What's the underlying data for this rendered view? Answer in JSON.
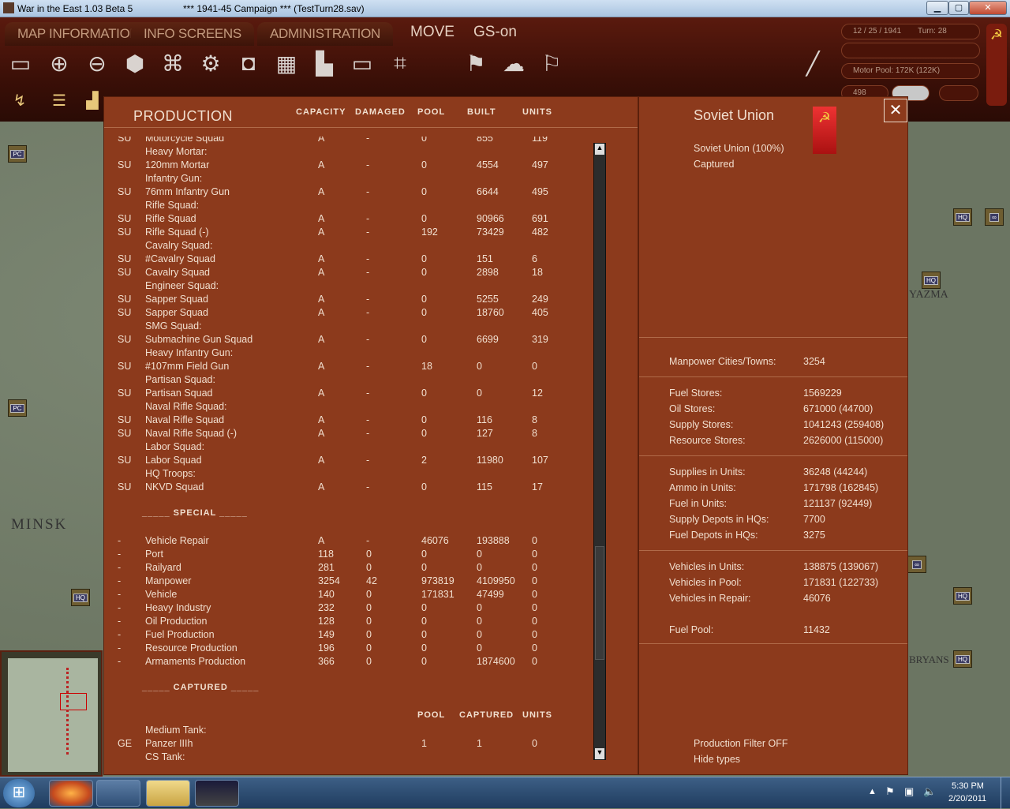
{
  "window": {
    "title": "War in the East 1.03 Beta 5",
    "scenario": "***   1941-45 Campaign   ***  (TestTurn28.sav)",
    "min": "▁",
    "max": "▢",
    "close": "✕"
  },
  "menu": {
    "map_info": "MAP INFORMATION",
    "info_screens": "INFO SCREENS",
    "administration": "ADMINISTRATION",
    "mode": "MOVE",
    "gs": "GS-on"
  },
  "status": {
    "date": "12 / 25 / 1941",
    "turn": "Turn: 28",
    "motor_pool": "Motor Pool: 172K (122K)",
    "value": "498"
  },
  "production": {
    "title": "PRODUCTION",
    "headers": {
      "capacity": "CAPACITY",
      "damaged": "DAMAGED",
      "pool": "POOL",
      "built": "BUILT",
      "units": "UNITS"
    },
    "rows": [
      {
        "nat": "SU",
        "name": "Motorcycle Squad",
        "cap": "A",
        "dmg": "-",
        "pool": "0",
        "built": "855",
        "units": "119"
      },
      {
        "cat": "Heavy Mortar:"
      },
      {
        "nat": "SU",
        "name": "120mm Mortar",
        "cap": "A",
        "dmg": "-",
        "pool": "0",
        "built": "4554",
        "units": "497"
      },
      {
        "cat": "Infantry Gun:"
      },
      {
        "nat": "SU",
        "name": "76mm Infantry Gun",
        "cap": "A",
        "dmg": "-",
        "pool": "0",
        "built": "6644",
        "units": "495"
      },
      {
        "cat": "Rifle Squad:"
      },
      {
        "nat": "SU",
        "name": "Rifle Squad",
        "cap": "A",
        "dmg": "-",
        "pool": "0",
        "built": "90966",
        "units": "691"
      },
      {
        "nat": "SU",
        "name": "Rifle Squad (-)",
        "cap": "A",
        "dmg": "-",
        "pool": "192",
        "built": "73429",
        "units": "482"
      },
      {
        "cat": "Cavalry Squad:"
      },
      {
        "nat": "SU",
        "name": "#Cavalry Squad",
        "cap": "A",
        "dmg": "-",
        "pool": "0",
        "built": "151",
        "units": "6"
      },
      {
        "nat": "SU",
        "name": "Cavalry Squad",
        "cap": "A",
        "dmg": "-",
        "pool": "0",
        "built": "2898",
        "units": "18"
      },
      {
        "cat": "Engineer Squad:"
      },
      {
        "nat": "SU",
        "name": "Sapper Squad",
        "cap": "A",
        "dmg": "-",
        "pool": "0",
        "built": "5255",
        "units": "249"
      },
      {
        "nat": "SU",
        "name": "Sapper Squad",
        "cap": "A",
        "dmg": "-",
        "pool": "0",
        "built": "18760",
        "units": "405"
      },
      {
        "cat": "SMG Squad:"
      },
      {
        "nat": "SU",
        "name": "Submachine Gun Squad",
        "cap": "A",
        "dmg": "-",
        "pool": "0",
        "built": "6699",
        "units": "319"
      },
      {
        "cat": "Heavy Infantry Gun:"
      },
      {
        "nat": "SU",
        "name": "#107mm Field Gun",
        "cap": "A",
        "dmg": "-",
        "pool": "18",
        "built": "0",
        "units": "0"
      },
      {
        "cat": "Partisan Squad:"
      },
      {
        "nat": "SU",
        "name": "Partisan Squad",
        "cap": "A",
        "dmg": "-",
        "pool": "0",
        "built": "0",
        "units": "12"
      },
      {
        "cat": "Naval Rifle Squad:"
      },
      {
        "nat": "SU",
        "name": "Naval Rifle Squad",
        "cap": "A",
        "dmg": "-",
        "pool": "0",
        "built": "116",
        "units": "8"
      },
      {
        "nat": "SU",
        "name": "Naval Rifle Squad (-)",
        "cap": "A",
        "dmg": "-",
        "pool": "0",
        "built": "127",
        "units": "8"
      },
      {
        "cat": "Labor Squad:"
      },
      {
        "nat": "SU",
        "name": "Labor Squad",
        "cap": "A",
        "dmg": "-",
        "pool": "2",
        "built": "11980",
        "units": "107"
      },
      {
        "cat": "HQ Troops:"
      },
      {
        "nat": "SU",
        "name": "NKVD Squad",
        "cap": "A",
        "dmg": "-",
        "pool": "0",
        "built": "115",
        "units": "17"
      }
    ],
    "special_title": "_____ SPECIAL _____",
    "special": [
      {
        "nat": "-",
        "name": "Vehicle Repair",
        "cap": "A",
        "dmg": "-",
        "pool": "46076",
        "built": "193888",
        "units": "0"
      },
      {
        "nat": "-",
        "name": "Port",
        "cap": "118",
        "dmg": "0",
        "pool": "0",
        "built": "0",
        "units": "0"
      },
      {
        "nat": "-",
        "name": "Railyard",
        "cap": "281",
        "dmg": "0",
        "pool": "0",
        "built": "0",
        "units": "0"
      },
      {
        "nat": "-",
        "name": "Manpower",
        "cap": "3254",
        "dmg": "42",
        "pool": "973819",
        "built": "4109950",
        "units": "0"
      },
      {
        "nat": "-",
        "name": "Vehicle",
        "cap": "140",
        "dmg": "0",
        "pool": "171831",
        "built": "47499",
        "units": "0"
      },
      {
        "nat": "-",
        "name": "Heavy Industry",
        "cap": "232",
        "dmg": "0",
        "pool": "0",
        "built": "0",
        "units": "0"
      },
      {
        "nat": "-",
        "name": "Oil Production",
        "cap": "128",
        "dmg": "0",
        "pool": "0",
        "built": "0",
        "units": "0"
      },
      {
        "nat": "-",
        "name": "Fuel Production",
        "cap": "149",
        "dmg": "0",
        "pool": "0",
        "built": "0",
        "units": "0"
      },
      {
        "nat": "-",
        "name": "Resource Production",
        "cap": "196",
        "dmg": "0",
        "pool": "0",
        "built": "0",
        "units": "0"
      },
      {
        "nat": "-",
        "name": "Armaments Production",
        "cap": "366",
        "dmg": "0",
        "pool": "0",
        "built": "1874600",
        "units": "0"
      }
    ],
    "captured_title": "_____ CAPTURED _____",
    "captured_headers": {
      "pool": "POOL",
      "captured": "CAPTURED",
      "units": "UNITS"
    },
    "captured": [
      {
        "cat": "Medium Tank:"
      },
      {
        "nat": "GE",
        "name": "Panzer IIIh",
        "pool": "1",
        "captured": "1",
        "units": "0"
      },
      {
        "cat": "CS Tank:"
      }
    ]
  },
  "side": {
    "nation": "Soviet Union",
    "line1": "Soviet Union  (100%)",
    "line2": "Captured",
    "close": "✕",
    "groups": [
      [
        {
          "k": "Manpower Cities/Towns:",
          "v": "3254"
        }
      ],
      [
        {
          "k": "Fuel Stores:",
          "v": "1569229"
        },
        {
          "k": "Oil Stores:",
          "v": "671000 (44700)"
        },
        {
          "k": "Supply Stores:",
          "v": "1041243 (259408)"
        },
        {
          "k": "Resource Stores:",
          "v": "2626000 (115000)"
        }
      ],
      [
        {
          "k": "Supplies in Units:",
          "v": "36248 (44244)"
        },
        {
          "k": "Ammo in Units:",
          "v": "171798 (162845)"
        },
        {
          "k": "Fuel in Units:",
          "v": "121137 (92449)"
        },
        {
          "k": "Supply Depots in HQs:",
          "v": "7700"
        },
        {
          "k": "Fuel Depots in HQs:",
          "v": "3275"
        }
      ],
      [
        {
          "k": "Vehicles in Units:",
          "v": "138875 (139067)"
        },
        {
          "k": "Vehicles in Pool:",
          "v": "171831 (122733)"
        },
        {
          "k": "Vehicles in Repair:",
          "v": "46076"
        }
      ],
      [
        {
          "k": "Fuel Pool:",
          "v": "11432"
        }
      ]
    ],
    "filter": "Production Filter OFF",
    "hide": "Hide types"
  },
  "map_labels": {
    "minsk": "MINSK",
    "vyazma": "YAZMA",
    "bryansk": "BRYANS",
    "pc": "PC",
    "hq": "HQ",
    "xxx": "XXX"
  },
  "taskbar": {
    "start": "⊞",
    "time": "5:30 PM",
    "date": "2/20/2011"
  },
  "colors": {
    "panel": "#8c3a1c",
    "topbar": "#3a0f07",
    "text": "#f1dfcf"
  }
}
